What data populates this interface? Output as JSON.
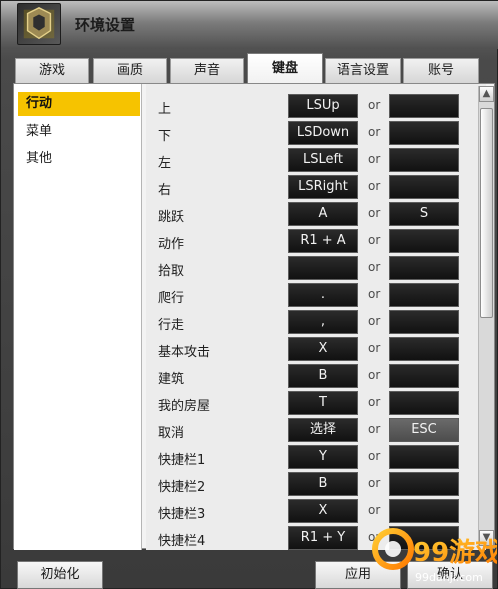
{
  "window": {
    "title": "环境设置",
    "app_icon": "game-logo-icon"
  },
  "tabs": [
    {
      "label": "游戏"
    },
    {
      "label": "画质"
    },
    {
      "label": "声音"
    },
    {
      "label": "键盘",
      "active": true
    },
    {
      "label": "语言设置"
    },
    {
      "label": "账号"
    }
  ],
  "sidebar": {
    "items": [
      {
        "label": "行动",
        "active": true
      },
      {
        "label": "菜单"
      },
      {
        "label": "其他"
      }
    ]
  },
  "bindings": [
    {
      "label": "上",
      "key1": "LSUp",
      "or": "or",
      "key2": ""
    },
    {
      "label": "下",
      "key1": "LSDown",
      "or": "or",
      "key2": ""
    },
    {
      "label": "左",
      "key1": "LSLeft",
      "or": "or",
      "key2": ""
    },
    {
      "label": "右",
      "key1": "LSRight",
      "or": "or",
      "key2": ""
    },
    {
      "label": "跳跃",
      "key1": "A",
      "or": "or",
      "key2": "S"
    },
    {
      "label": "动作",
      "key1": "R1 + A",
      "or": "or",
      "key2": ""
    },
    {
      "label": "拾取",
      "key1": "",
      "or": "or",
      "key2": ""
    },
    {
      "label": "爬行",
      "key1": ".",
      "or": "or",
      "key2": ""
    },
    {
      "label": "行走",
      "key1": ",",
      "or": "or",
      "key2": ""
    },
    {
      "label": "基本攻击",
      "key1": "X",
      "or": "or",
      "key2": ""
    },
    {
      "label": "建筑",
      "key1": "B",
      "or": "or",
      "key2": ""
    },
    {
      "label": "我的房屋",
      "key1": "T",
      "or": "or",
      "key2": ""
    },
    {
      "label": "取消",
      "key1": "选择",
      "or": "or",
      "key2": "ESC"
    },
    {
      "label": "快捷栏1",
      "key1": "Y",
      "or": "or",
      "key2": ""
    },
    {
      "label": "快捷栏2",
      "key1": "B",
      "or": "or",
      "key2": ""
    },
    {
      "label": "快捷栏3",
      "key1": "X",
      "or": "or",
      "key2": ""
    },
    {
      "label": "快捷栏4",
      "key1": "R1 + Y",
      "or": "or",
      "key2": ""
    }
  ],
  "buttons": {
    "reset": "初始化",
    "apply": "应用",
    "ok": "确认"
  },
  "watermark": {
    "text": "99游戏",
    "site": "99danji.com"
  },
  "colors": {
    "accent": "#f6c300",
    "key_bg": "#151515",
    "panel_bg": "#ececec"
  }
}
